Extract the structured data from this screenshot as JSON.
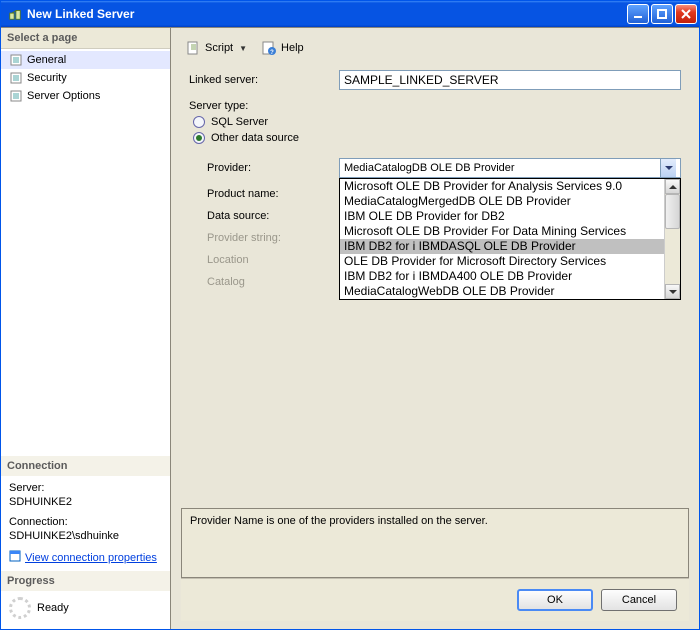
{
  "window": {
    "title": "New Linked Server"
  },
  "sidebar": {
    "select_page": "Select a page",
    "items": [
      {
        "label": "General"
      },
      {
        "label": "Security"
      },
      {
        "label": "Server Options"
      }
    ],
    "connection_header": "Connection",
    "server_label": "Server:",
    "server_value": "SDHUINKE2",
    "connection_label": "Connection:",
    "connection_value": "SDHUINKE2\\sdhuinke",
    "view_conn_props": "View connection properties",
    "progress_header": "Progress",
    "ready": "Ready"
  },
  "toolbar": {
    "script": "Script",
    "help": "Help"
  },
  "form": {
    "linked_server_label": "Linked server:",
    "linked_server_value": "SAMPLE_LINKED_SERVER",
    "server_type_label": "Server type:",
    "radio_sql": "SQL Server",
    "radio_other": "Other data source",
    "provider_label": "Provider:",
    "provider_selected": "MediaCatalogDB OLE DB Provider",
    "product_name_label": "Product name:",
    "data_source_label": "Data source:",
    "provider_string_label": "Provider string:",
    "location_label": "Location",
    "catalog_label": "Catalog",
    "provider_options": [
      "Microsoft OLE DB Provider for Analysis Services 9.0",
      "MediaCatalogMergedDB OLE DB Provider",
      "IBM OLE DB Provider for DB2",
      "Microsoft OLE DB Provider For Data Mining Services",
      "IBM DB2 for i IBMDASQL OLE DB Provider",
      "OLE DB Provider for Microsoft Directory Services",
      "IBM DB2 for i IBMDA400 OLE DB Provider",
      "MediaCatalogWebDB OLE DB Provider"
    ]
  },
  "help_text": "Provider Name is one of the providers installed on the server.",
  "buttons": {
    "ok": "OK",
    "cancel": "Cancel"
  }
}
